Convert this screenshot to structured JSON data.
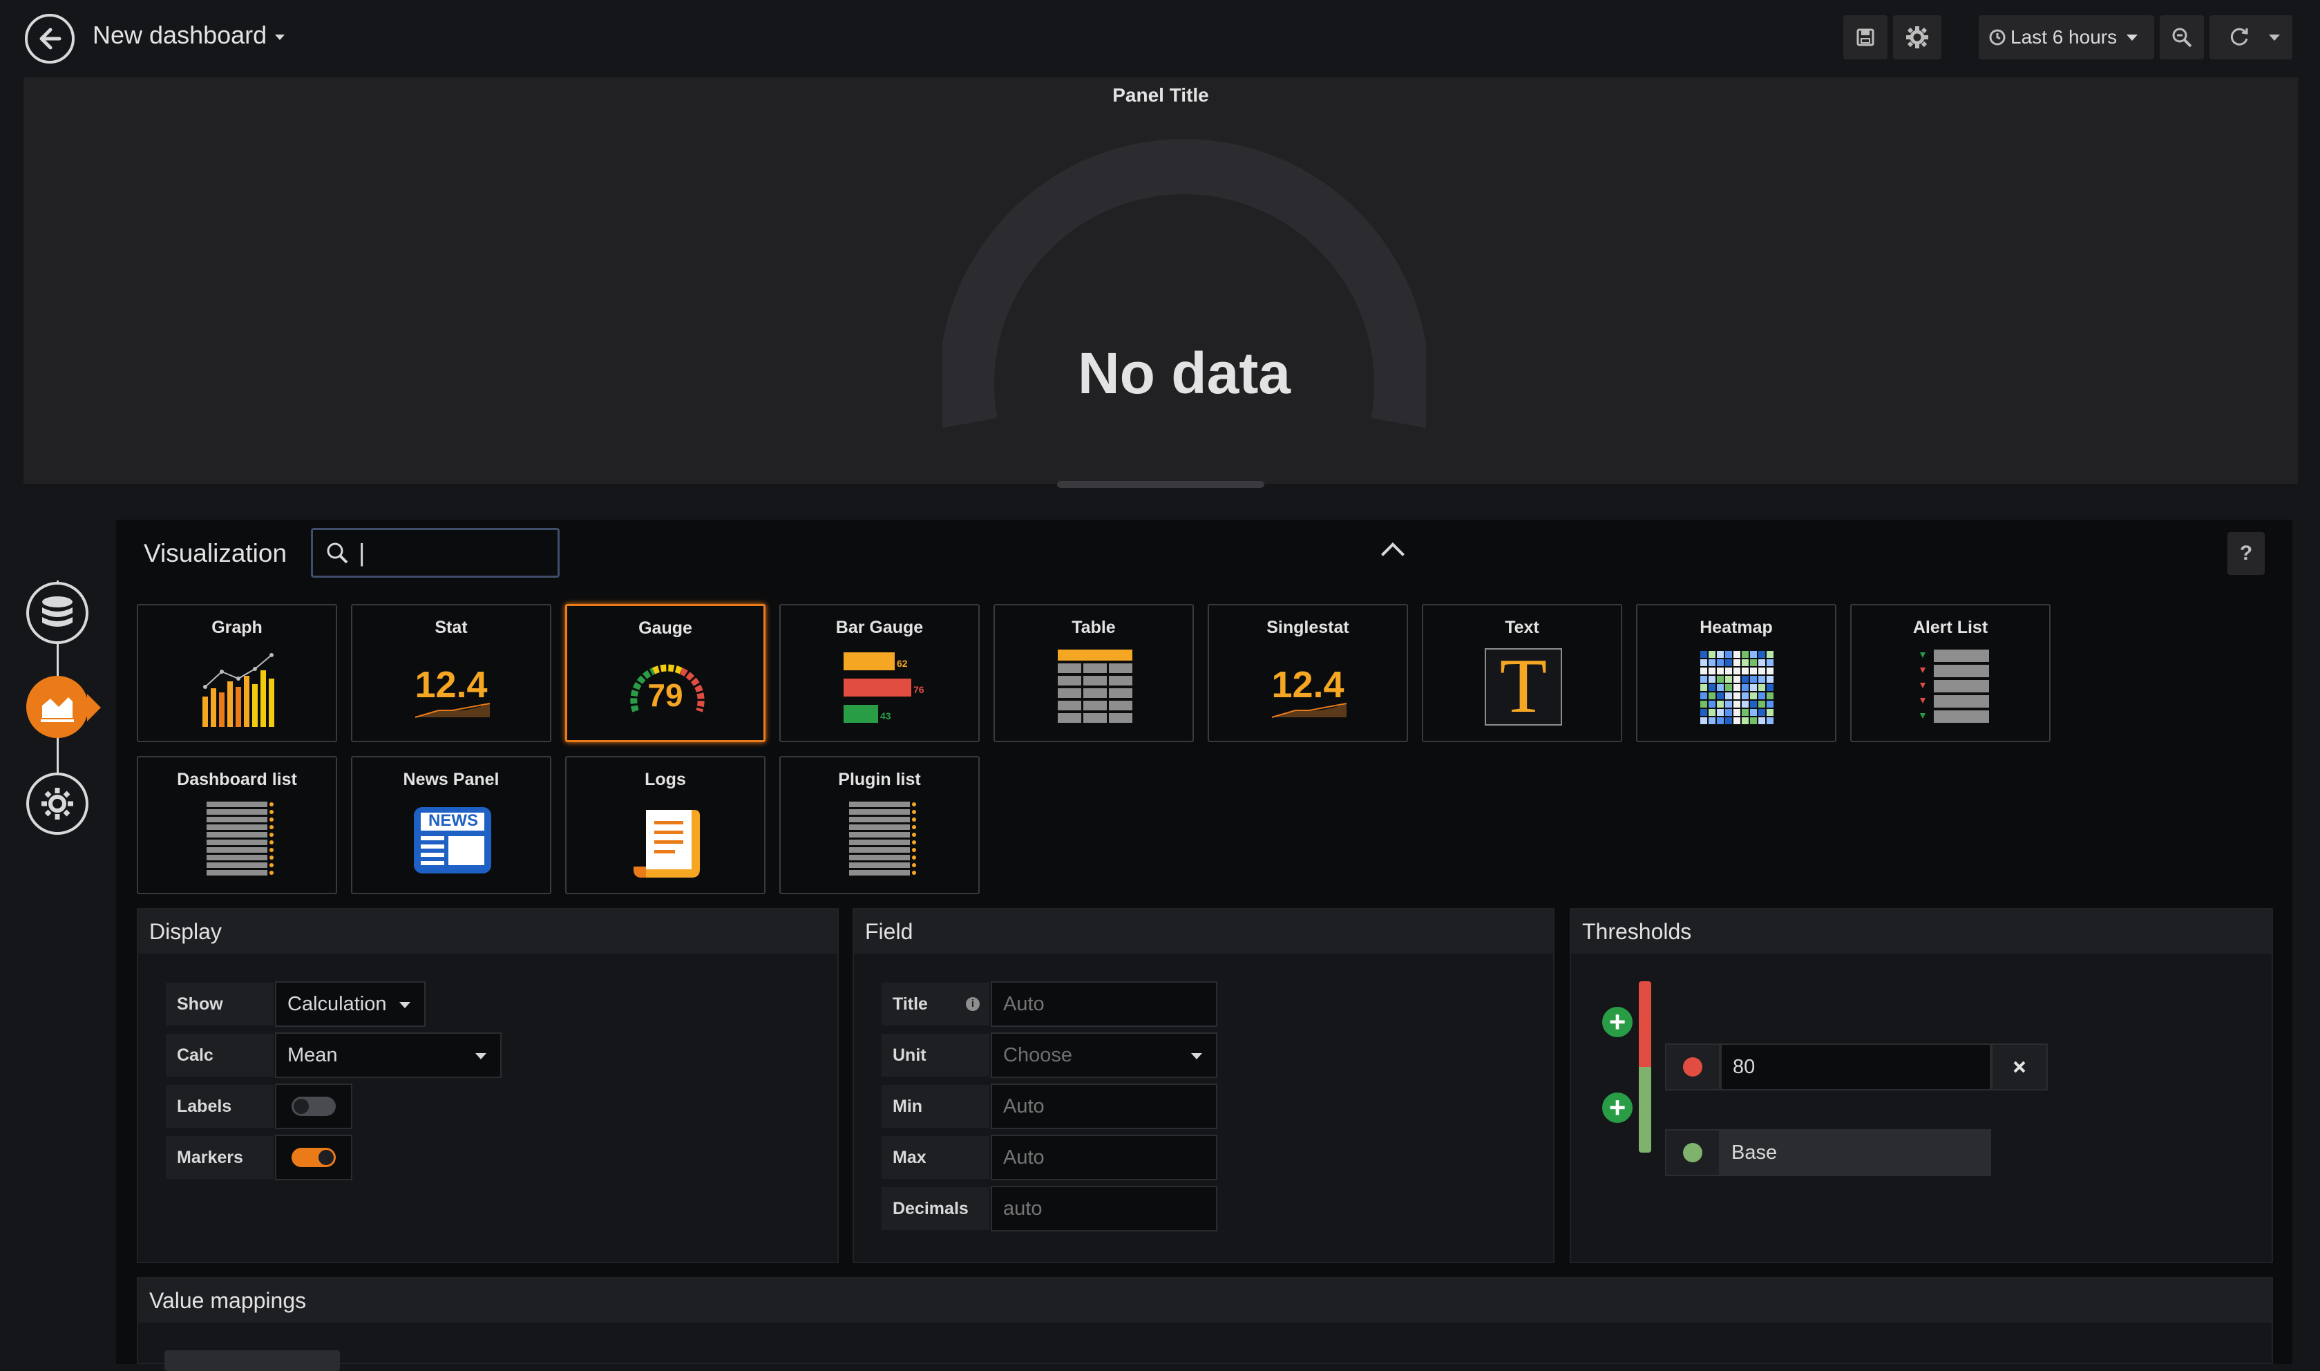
{
  "header": {
    "dashboard_title": "New dashboard",
    "time_range": "Last 6 hours"
  },
  "panel": {
    "title": "Panel Title",
    "no_data": "No data"
  },
  "visualization": {
    "label": "Visualization",
    "search_value": "|",
    "help": "?",
    "cards": [
      {
        "name": "Graph"
      },
      {
        "name": "Stat",
        "sample": "12.4"
      },
      {
        "name": "Gauge",
        "sample": "79",
        "selected": true
      },
      {
        "name": "Bar Gauge",
        "bars": [
          "62",
          "76",
          "43"
        ]
      },
      {
        "name": "Table"
      },
      {
        "name": "Singlestat",
        "sample": "12.4"
      },
      {
        "name": "Text",
        "glyph": "T"
      },
      {
        "name": "Heatmap"
      },
      {
        "name": "Alert List"
      },
      {
        "name": "Dashboard list"
      },
      {
        "name": "News Panel",
        "glyph": "NEWS"
      },
      {
        "name": "Logs"
      },
      {
        "name": "Plugin list"
      }
    ]
  },
  "display": {
    "title": "Display",
    "show_label": "Show",
    "show_value": "Calculation",
    "calc_label": "Calc",
    "calc_value": "Mean",
    "labels_label": "Labels",
    "labels_on": false,
    "markers_label": "Markers",
    "markers_on": true
  },
  "field": {
    "title": "Field",
    "title_label": "Title",
    "title_placeholder": "Auto",
    "unit_label": "Unit",
    "unit_placeholder": "Choose",
    "min_label": "Min",
    "min_placeholder": "Auto",
    "max_label": "Max",
    "max_placeholder": "Auto",
    "decimals_label": "Decimals",
    "decimals_placeholder": "auto"
  },
  "thresholds": {
    "title": "Thresholds",
    "items": [
      {
        "value": "80",
        "color": "#e24d42"
      },
      {
        "value": "Base",
        "color": "#7eb26d"
      }
    ]
  },
  "value_mappings": {
    "title": "Value mappings"
  },
  "colors": {
    "accent": "#eb7b18",
    "background": "#141619",
    "panel": "#212124",
    "add": "#299c46",
    "red": "#e24d42",
    "green": "#7eb26d"
  }
}
